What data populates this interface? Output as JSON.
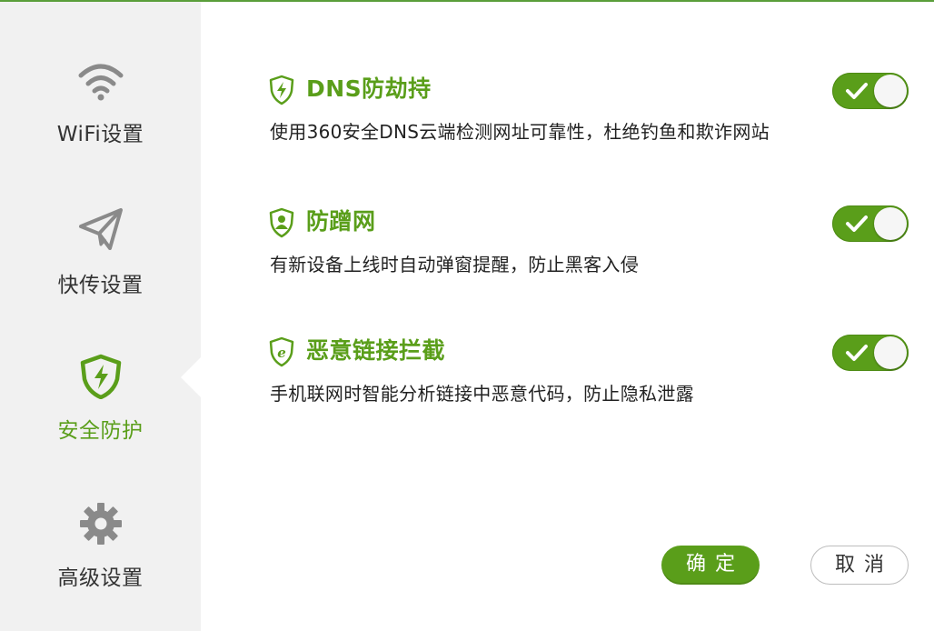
{
  "sidebar": {
    "items": [
      {
        "id": "wifi",
        "label": "WiFi设置",
        "icon": "wifi-icon",
        "active": false
      },
      {
        "id": "transfer",
        "label": "快传设置",
        "icon": "paper-plane-icon",
        "active": false
      },
      {
        "id": "security",
        "label": "安全防护",
        "icon": "shield-lightning-icon",
        "active": true
      },
      {
        "id": "advanced",
        "label": "高级设置",
        "icon": "gear-icon",
        "active": false
      }
    ]
  },
  "features": [
    {
      "title": "DNS防劫持",
      "description": "使用360安全DNS云端检测网址可靠性，杜绝钓鱼和欺诈网站",
      "icon": "shield-lightning-icon",
      "enabled": true
    },
    {
      "title": "防蹭网",
      "description": "有新设备上线时自动弹窗提醒，防止黑客入侵",
      "icon": "shield-user-icon",
      "enabled": true
    },
    {
      "title": "恶意链接拦截",
      "description": "手机联网时智能分析链接中恶意代码，防止隐私泄露",
      "icon": "shield-e-icon",
      "enabled": true
    }
  ],
  "buttons": {
    "ok_label": "确定",
    "cancel_label": "取消"
  },
  "colors": {
    "accent": "#5a9e1a",
    "sidebar_bg": "#f1f1f1",
    "icon_gray": "#8a8a8a"
  }
}
